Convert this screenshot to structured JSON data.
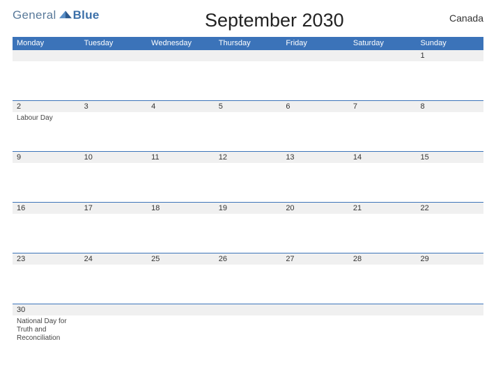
{
  "logo": {
    "part1": "General",
    "part2": "Blue"
  },
  "title": "September 2030",
  "region": "Canada",
  "days_of_week": [
    "Monday",
    "Tuesday",
    "Wednesday",
    "Thursday",
    "Friday",
    "Saturday",
    "Sunday"
  ],
  "weeks": [
    [
      {
        "num": "",
        "event": ""
      },
      {
        "num": "",
        "event": ""
      },
      {
        "num": "",
        "event": ""
      },
      {
        "num": "",
        "event": ""
      },
      {
        "num": "",
        "event": ""
      },
      {
        "num": "",
        "event": ""
      },
      {
        "num": "1",
        "event": ""
      }
    ],
    [
      {
        "num": "2",
        "event": "Labour Day"
      },
      {
        "num": "3",
        "event": ""
      },
      {
        "num": "4",
        "event": ""
      },
      {
        "num": "5",
        "event": ""
      },
      {
        "num": "6",
        "event": ""
      },
      {
        "num": "7",
        "event": ""
      },
      {
        "num": "8",
        "event": ""
      }
    ],
    [
      {
        "num": "9",
        "event": ""
      },
      {
        "num": "10",
        "event": ""
      },
      {
        "num": "11",
        "event": ""
      },
      {
        "num": "12",
        "event": ""
      },
      {
        "num": "13",
        "event": ""
      },
      {
        "num": "14",
        "event": ""
      },
      {
        "num": "15",
        "event": ""
      }
    ],
    [
      {
        "num": "16",
        "event": ""
      },
      {
        "num": "17",
        "event": ""
      },
      {
        "num": "18",
        "event": ""
      },
      {
        "num": "19",
        "event": ""
      },
      {
        "num": "20",
        "event": ""
      },
      {
        "num": "21",
        "event": ""
      },
      {
        "num": "22",
        "event": ""
      }
    ],
    [
      {
        "num": "23",
        "event": ""
      },
      {
        "num": "24",
        "event": ""
      },
      {
        "num": "25",
        "event": ""
      },
      {
        "num": "26",
        "event": ""
      },
      {
        "num": "27",
        "event": ""
      },
      {
        "num": "28",
        "event": ""
      },
      {
        "num": "29",
        "event": ""
      }
    ],
    [
      {
        "num": "30",
        "event": "National Day for Truth and Reconciliation"
      },
      {
        "num": "",
        "event": ""
      },
      {
        "num": "",
        "event": ""
      },
      {
        "num": "",
        "event": ""
      },
      {
        "num": "",
        "event": ""
      },
      {
        "num": "",
        "event": ""
      },
      {
        "num": "",
        "event": ""
      }
    ]
  ]
}
